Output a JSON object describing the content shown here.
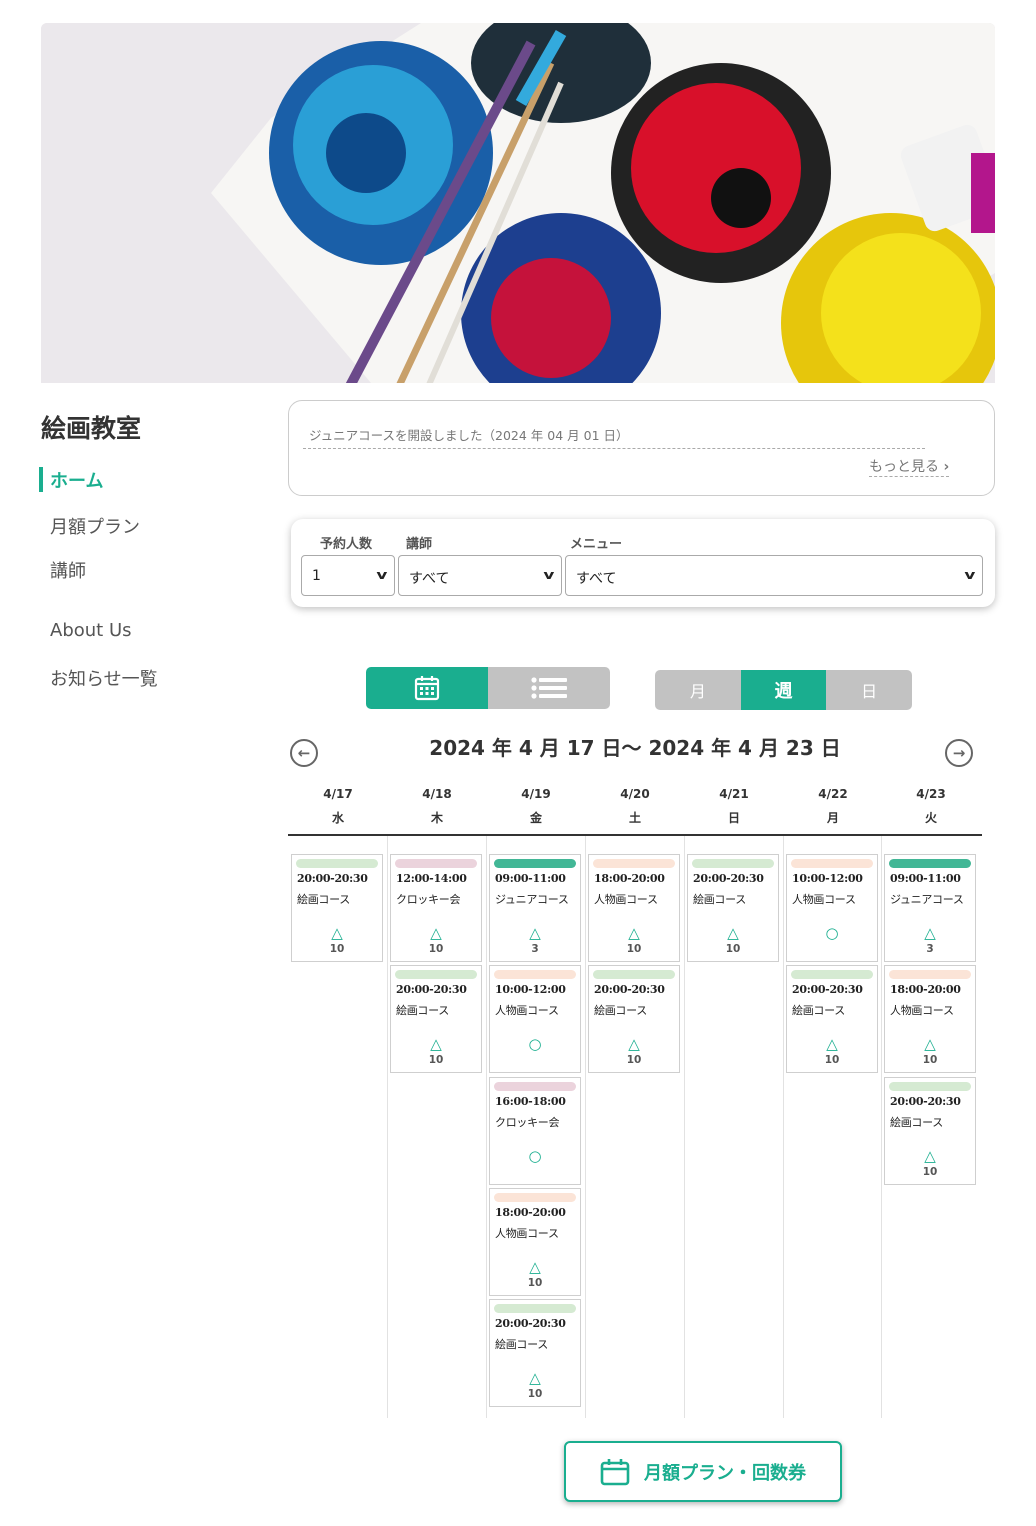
{
  "site": {
    "title": "絵画教室"
  },
  "nav": {
    "home": "ホーム",
    "monthly_plan": "月額プラン",
    "instructor": "講師",
    "about": "About Us",
    "news_list": "お知らせ一覧"
  },
  "news": {
    "item": "ジュニアコースを開設しました（2024 年 04 月 01 日）",
    "more": "もっと見る"
  },
  "filters": {
    "people_label": "予約人数",
    "people_value": "1",
    "instructor_label": "講師",
    "instructor_value": "すべて",
    "menu_label": "メニュー",
    "menu_value": "すべて"
  },
  "view": {
    "range_month": "月",
    "range_week": "週",
    "range_day": "日"
  },
  "calendar": {
    "title": "2024 年 4 月 17 日〜 2024 年 4 月 23 日",
    "days": [
      {
        "date": "4/17",
        "dow": "水"
      },
      {
        "date": "4/18",
        "dow": "木"
      },
      {
        "date": "4/19",
        "dow": "金"
      },
      {
        "date": "4/20",
        "dow": "土"
      },
      {
        "date": "4/21",
        "dow": "日"
      },
      {
        "date": "4/22",
        "dow": "月"
      },
      {
        "date": "4/23",
        "dow": "火"
      }
    ],
    "slots": [
      [
        {
          "time": "20:00-20:30",
          "course": "絵画コース",
          "mark": "△",
          "count": "10",
          "color": "#d5ead2"
        }
      ],
      [
        {
          "time": "12:00-14:00",
          "course": "クロッキー会",
          "mark": "△",
          "count": "10",
          "color": "#ebd3dc"
        },
        {
          "time": "20:00-20:30",
          "course": "絵画コース",
          "mark": "△",
          "count": "10",
          "color": "#d5ead2"
        }
      ],
      [
        {
          "time": "09:00-11:00",
          "course": "ジュニアコース",
          "mark": "△",
          "count": "3",
          "color": "#42b796"
        },
        {
          "time": "10:00-12:00",
          "course": "人物画コース",
          "mark": "○",
          "count": "",
          "color": "#fbe4d7"
        },
        {
          "time": "16:00-18:00",
          "course": "クロッキー会",
          "mark": "○",
          "count": "",
          "color": "#ebd3dc"
        },
        {
          "time": "18:00-20:00",
          "course": "人物画コース",
          "mark": "△",
          "count": "10",
          "color": "#fbe4d7"
        },
        {
          "time": "20:00-20:30",
          "course": "絵画コース",
          "mark": "△",
          "count": "10",
          "color": "#d5ead2"
        }
      ],
      [
        {
          "time": "18:00-20:00",
          "course": "人物画コース",
          "mark": "△",
          "count": "10",
          "color": "#fbe4d7"
        },
        {
          "time": "20:00-20:30",
          "course": "絵画コース",
          "mark": "△",
          "count": "10",
          "color": "#d5ead2"
        }
      ],
      [
        {
          "time": "20:00-20:30",
          "course": "絵画コース",
          "mark": "△",
          "count": "10",
          "color": "#d5ead2"
        }
      ],
      [
        {
          "time": "10:00-12:00",
          "course": "人物画コース",
          "mark": "○",
          "count": "",
          "color": "#fbe4d7"
        },
        {
          "time": "20:00-20:30",
          "course": "絵画コース",
          "mark": "△",
          "count": "10",
          "color": "#d5ead2"
        }
      ],
      [
        {
          "time": "09:00-11:00",
          "course": "ジュニアコース",
          "mark": "△",
          "count": "3",
          "color": "#42b796"
        },
        {
          "time": "18:00-20:00",
          "course": "人物画コース",
          "mark": "△",
          "count": "10",
          "color": "#fbe4d7"
        },
        {
          "time": "20:00-20:30",
          "course": "絵画コース",
          "mark": "△",
          "count": "10",
          "color": "#d5ead2"
        }
      ]
    ]
  },
  "plan_button": {
    "label": "月額プラン・回数券"
  },
  "icons": {
    "calendar_view": "calendar-icon",
    "list_view": "list-icon",
    "prev": "arrow-left-circle-icon",
    "next": "arrow-right-circle-icon",
    "more": "chevron-right-icon",
    "select": "chevron-down-icon"
  },
  "colors": {
    "accent": "#1aae8f",
    "inactive": "#c2c2c2"
  }
}
